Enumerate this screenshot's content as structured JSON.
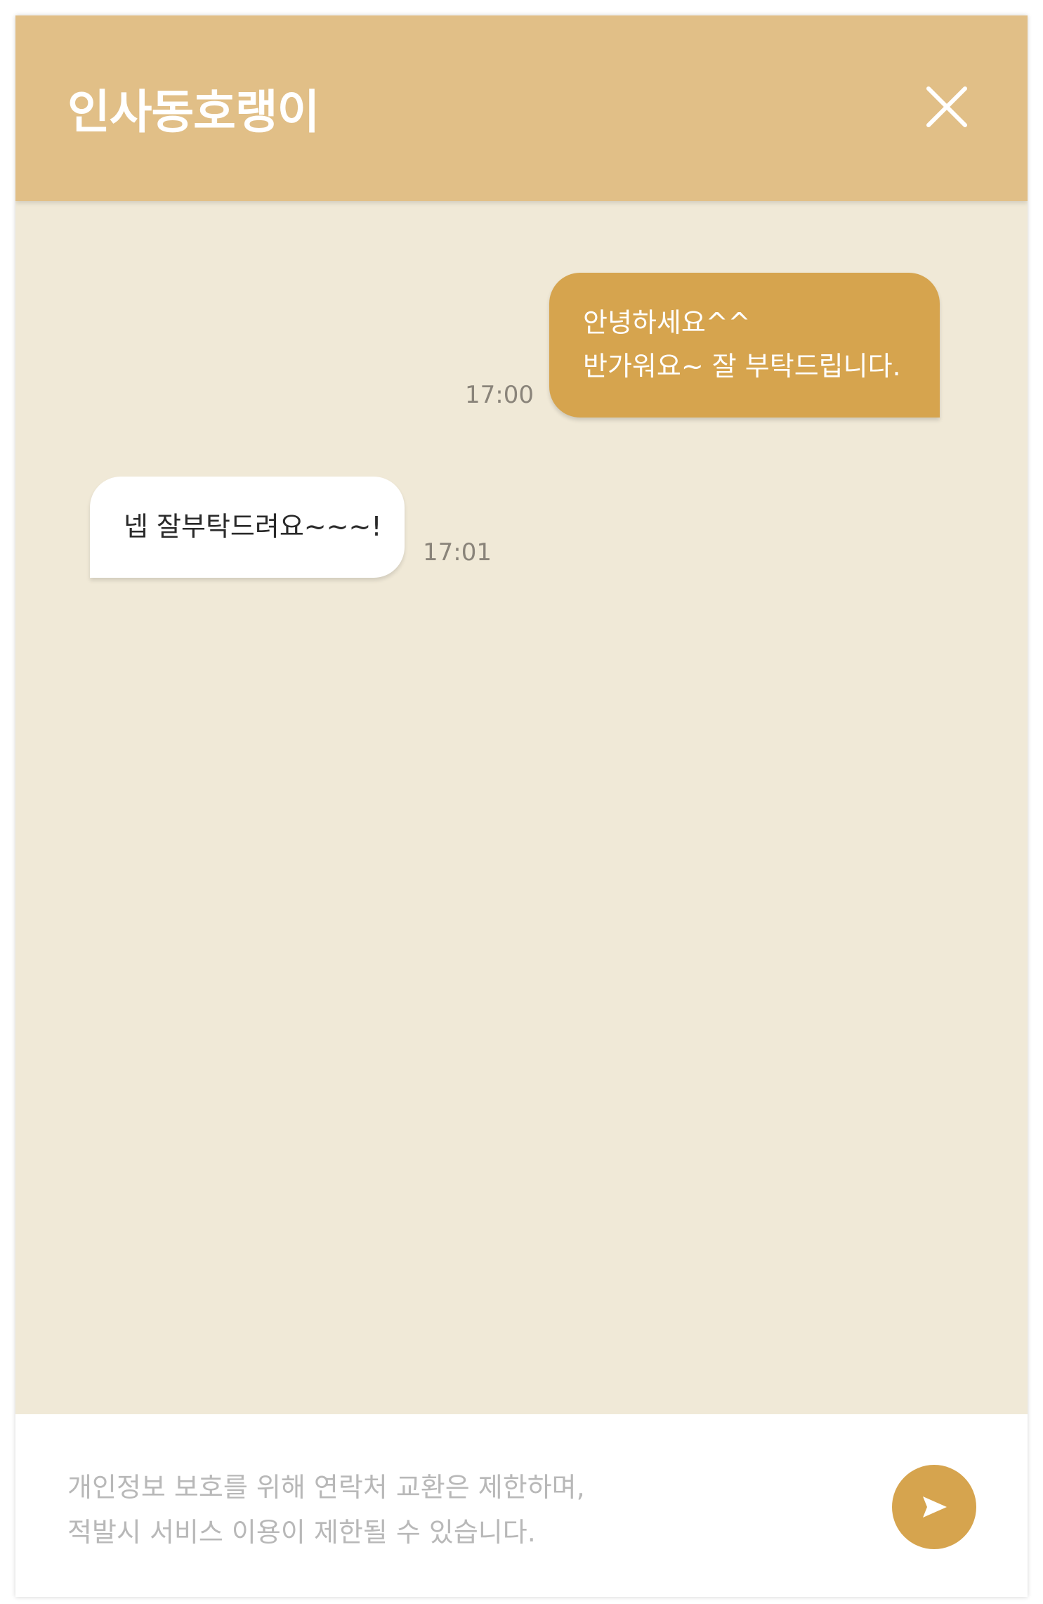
{
  "header": {
    "title": "인사동호랭이",
    "close_icon": "close-icon"
  },
  "messages": [
    {
      "direction": "outgoing",
      "lines": [
        "안녕하세요^^",
        "반가워요~ 잘 부탁드립니다."
      ],
      "time": "17:00"
    },
    {
      "direction": "incoming",
      "lines": [
        "넵 잘부탁드려요~~~!"
      ],
      "time": "17:01"
    }
  ],
  "composer": {
    "placeholder_lines": [
      "개인정보 보호를 위해 연락처 교환은 제한하며,",
      "적발시 서비스 이용이 제한될 수 있습니다."
    ],
    "send_icon": "send-icon"
  },
  "colors": {
    "header_bg": "#e1bf87",
    "chat_bg": "#f0e9d7",
    "outgoing_bubble": "#d6a44e",
    "incoming_bubble": "#ffffff",
    "send_button": "#d6a44e"
  }
}
